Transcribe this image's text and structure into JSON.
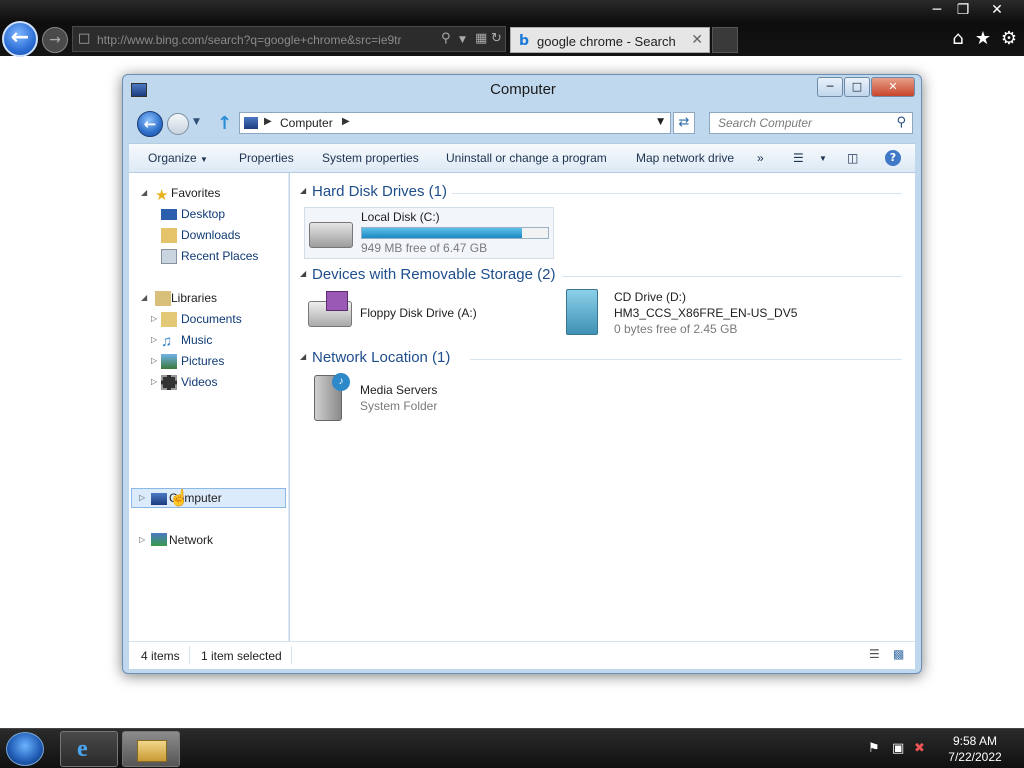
{
  "browser": {
    "address_url": "http://www.bing.com/search?q=google+chrome&src=ie9tr",
    "tab_title": "google chrome - Search"
  },
  "explorer": {
    "title": "Computer",
    "breadcrumb": "Computer",
    "search_placeholder": "Search Computer",
    "toolbar": {
      "organize": "Organize",
      "properties": "Properties",
      "system_properties": "System properties",
      "uninstall": "Uninstall or change a program",
      "map_network": "Map network drive",
      "more": "»"
    },
    "nav": {
      "favorites": "Favorites",
      "desktop": "Desktop",
      "downloads": "Downloads",
      "recent": "Recent Places",
      "libraries": "Libraries",
      "documents": "Documents",
      "music": "Music",
      "pictures": "Pictures",
      "videos": "Videos",
      "computer": "Computer",
      "network": "Network"
    },
    "groups": {
      "hdd": "Hard Disk Drives (1)",
      "removable": "Devices with Removable Storage (2)",
      "network": "Network Location (1)"
    },
    "items": {
      "local_disk": {
        "name": "Local Disk (C:)",
        "free": "949 MB free of 6.47 GB",
        "used_fraction": 0.86
      },
      "floppy": {
        "name": "Floppy Disk Drive (A:)"
      },
      "cd": {
        "name": "CD Drive (D:)",
        "label": "HM3_CCS_X86FRE_EN-US_DV5",
        "free": "0 bytes free of 2.45 GB"
      },
      "media": {
        "name": "Media Servers",
        "type": "System Folder"
      }
    },
    "status": {
      "count": "4 items",
      "selected": "1 item selected"
    }
  },
  "taskbar": {
    "time": "9:58 AM",
    "date": "7/22/2022"
  }
}
